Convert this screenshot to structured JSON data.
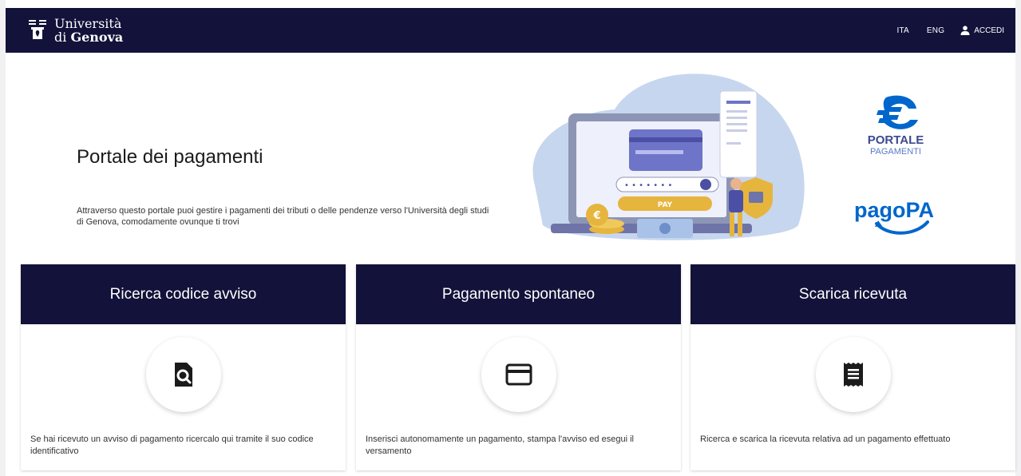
{
  "header": {
    "logo_line1": "Università",
    "logo_line2_prefix": "di ",
    "logo_line2_bold": "Genova",
    "lang_ita": "ITA",
    "lang_eng": "ENG",
    "login_label": "ACCEDI"
  },
  "hero": {
    "title": "Portale dei pagamenti",
    "description": "Attraverso questo portale puoi gestire i pagamenti dei tributi o delle pendenze verso l'Università degli studi di Genova, comodamente ovunque ti trovi",
    "illustration": {
      "pay_label": "PAY"
    }
  },
  "logos": {
    "portale_line1": "PORTALE",
    "portale_line2": "PAGAMENTI",
    "pagopa": "pagoPA"
  },
  "cards": [
    {
      "title": "Ricerca codice avviso",
      "icon": "document-search-icon",
      "text": "Se hai ricevuto un avviso di pagamento ricercalo qui tramite il suo codice identificativo"
    },
    {
      "title": "Pagamento spontaneo",
      "icon": "credit-card-icon",
      "text": "Inserisci autonomamente un pagamento, stampa l'avviso ed esegui il versamento"
    },
    {
      "title": "Scarica ricevuta",
      "icon": "receipt-icon",
      "text": "Ricerca e scarica la ricevuta relativa ad un pagamento effettuato"
    }
  ],
  "colors": {
    "header_bg": "#12123a",
    "accent_blue": "#0066cc",
    "illustration_blob": "#c6d6ee",
    "coin_gold": "#e6b53e"
  }
}
